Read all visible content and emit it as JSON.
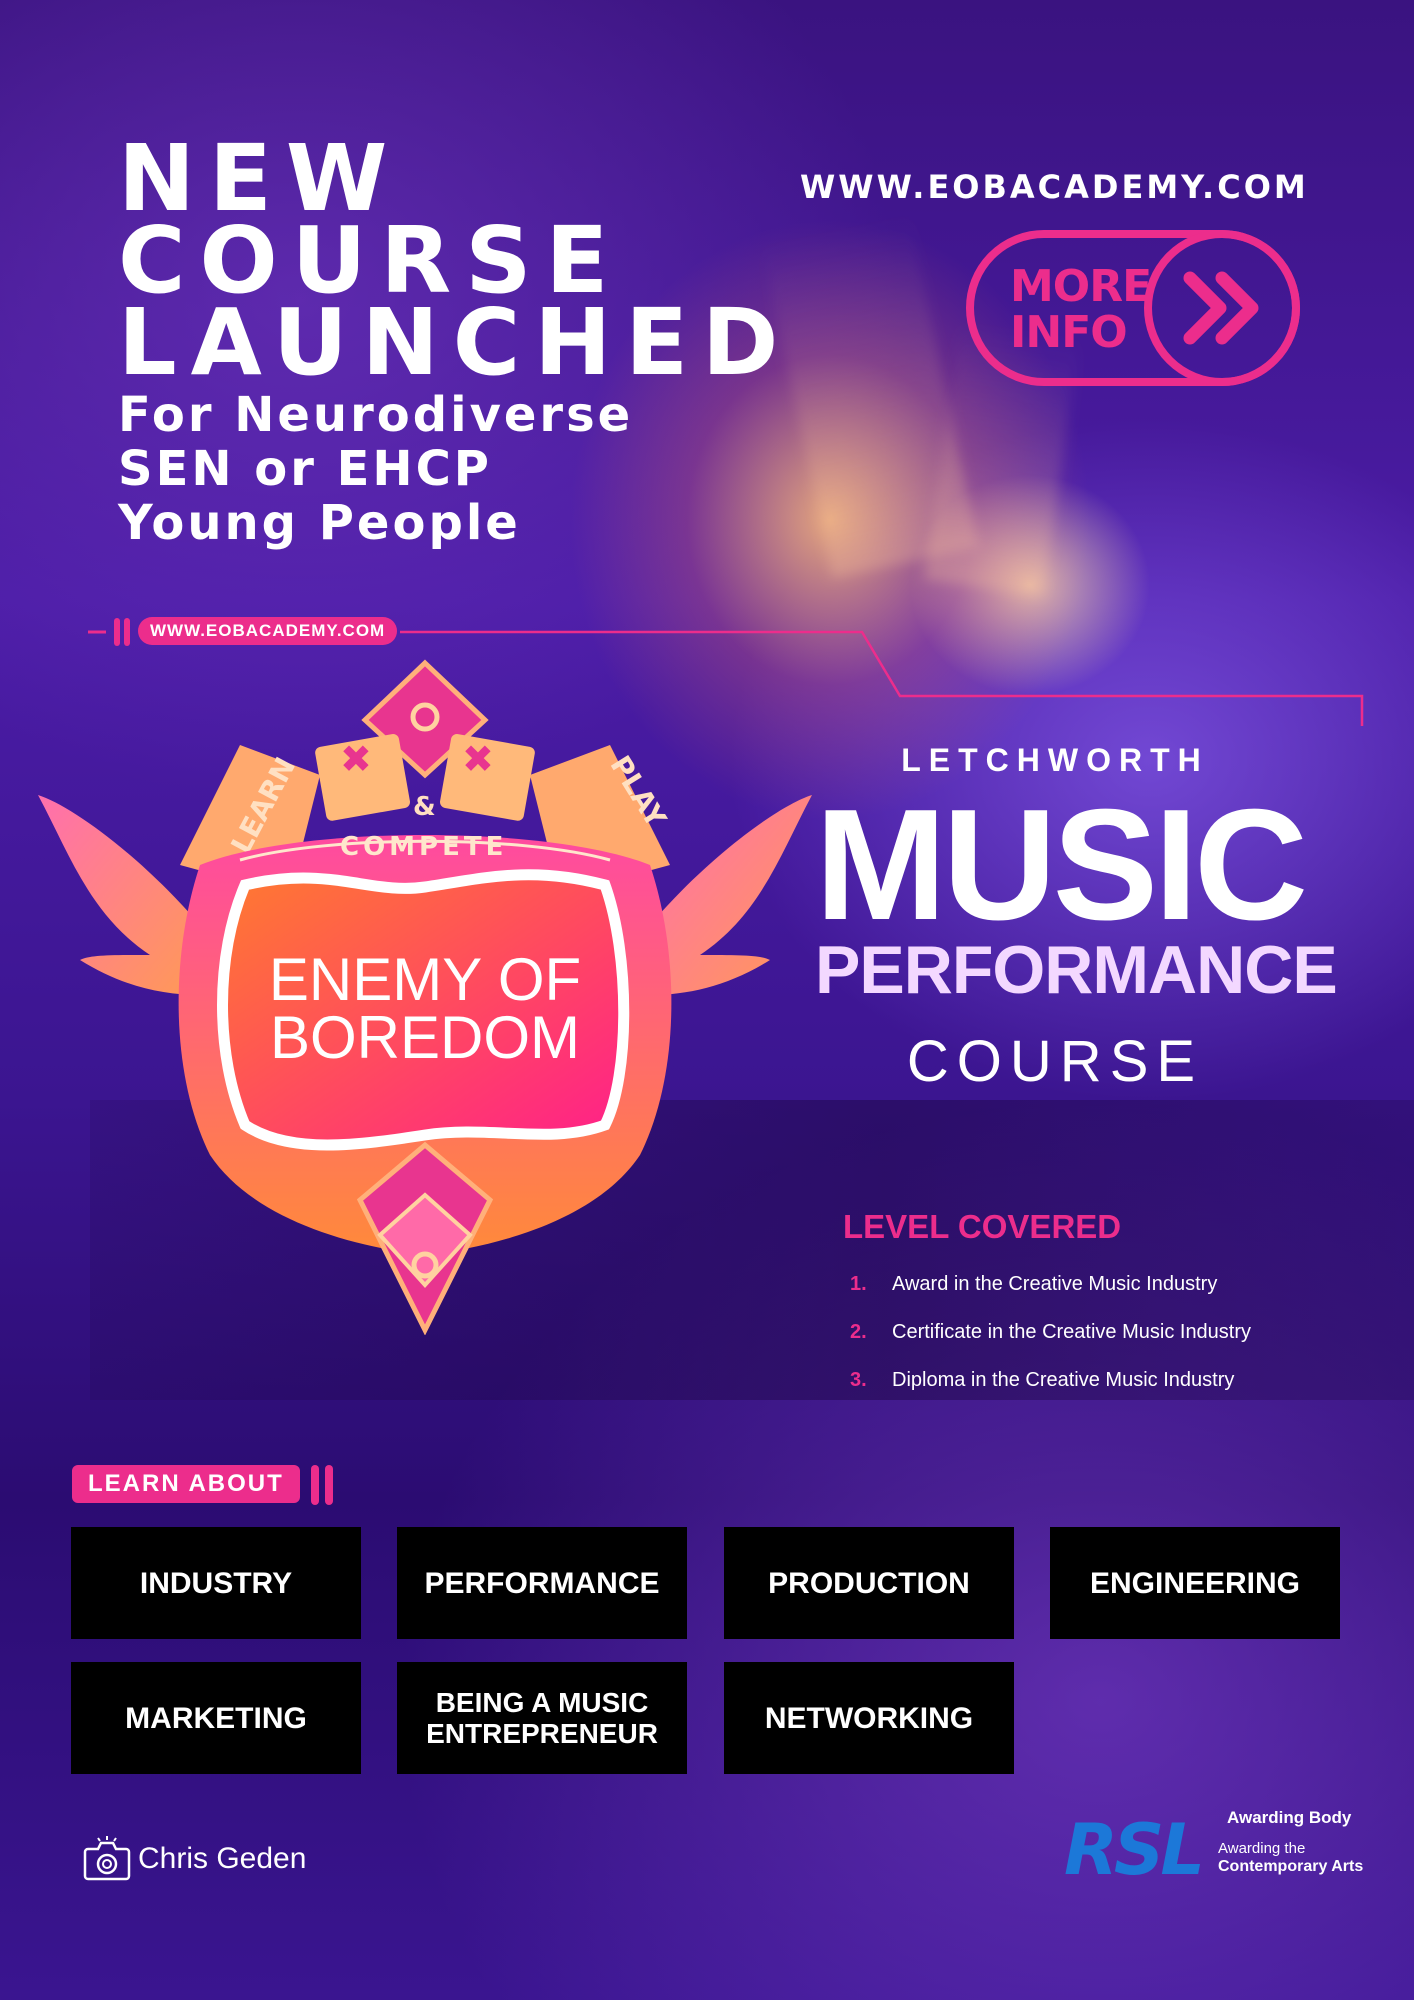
{
  "headline": {
    "line1": "NEW",
    "line2": "COURSE",
    "line3": "LAUNCHED"
  },
  "subhead": {
    "line1": "For Neurodiverse",
    "line2": "SEN or EHCP",
    "line3": "Young People"
  },
  "website": "WWW.EOBACADEMY.COM",
  "more_info": {
    "line1": "MORE",
    "line2": "INFO"
  },
  "website_pill": "WWW.EOBACADEMY.COM",
  "badge": {
    "learn": "LEARN",
    "play": "PLAY",
    "ampersand": "&",
    "compete": "COMPETE",
    "name_line1": "ENEMY OF",
    "name_line2": "BOREDOM"
  },
  "course_title": {
    "location": "LETCHWORTH",
    "music": "MUSIC",
    "performance": "PERFORMANCE",
    "course": "COURSE"
  },
  "levels": {
    "title": "LEVEL COVERED",
    "items": [
      {
        "num": "1.",
        "text": "Award in the Creative Music Industry"
      },
      {
        "num": "2.",
        "text": "Certificate in the Creative Music Industry"
      },
      {
        "num": "3.",
        "text": "Diploma in the Creative Music Industry"
      }
    ]
  },
  "learn_about": {
    "label": "LEARN ABOUT",
    "topics": [
      "INDUSTRY",
      "PERFORMANCE",
      "PRODUCTION",
      "ENGINEERING",
      "MARKETING",
      "BEING A MUSIC ENTREPRENEUR",
      "NETWORKING"
    ]
  },
  "photo_credit": "Chris Geden",
  "awarding": {
    "logo": "RSL",
    "label": "Awarding Body",
    "line1": "Awarding the",
    "line2": "Contemporary Arts"
  },
  "colors": {
    "accent_pink": "#ec2d8c",
    "rsl_blue": "#1c78d8",
    "tile_black": "#000000"
  },
  "icons": [
    "camera-icon",
    "double-chevron-right-icon"
  ]
}
